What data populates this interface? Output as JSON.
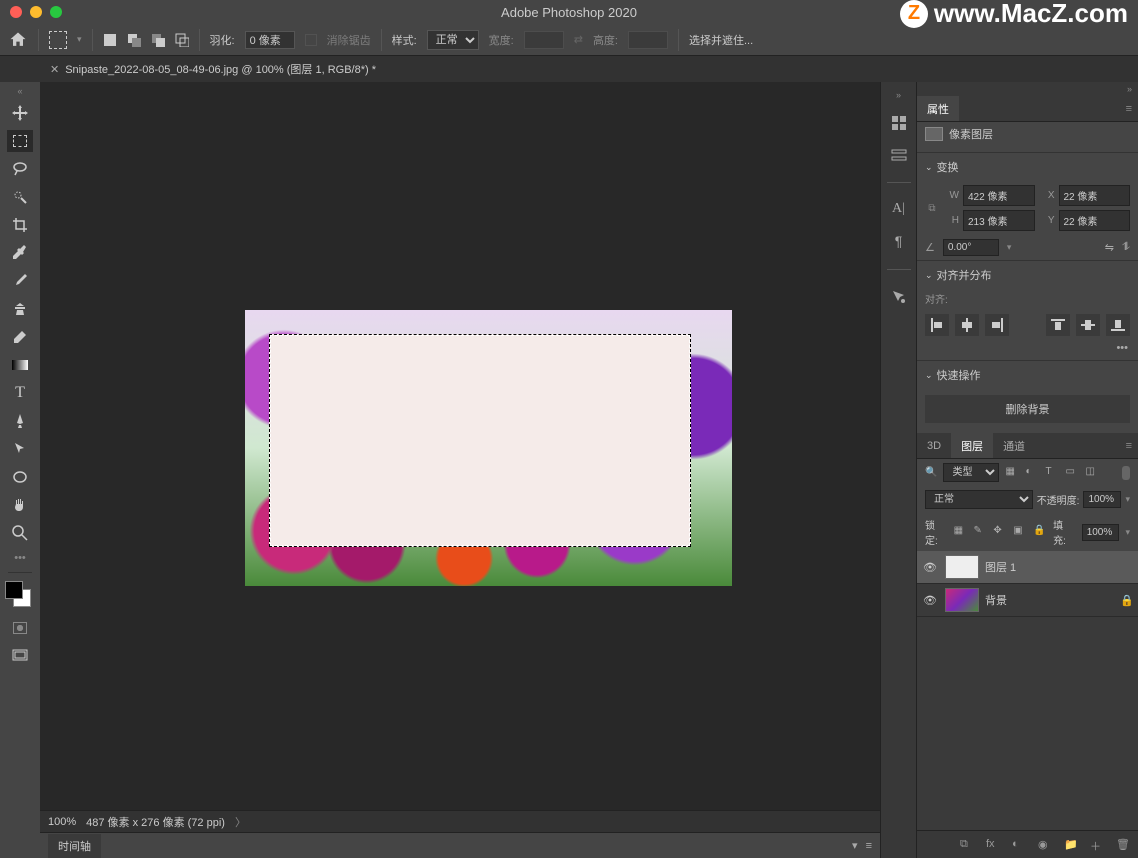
{
  "title": "Adobe Photoshop 2020",
  "watermark": "www.MacZ.com",
  "watermark_badge": "Z",
  "options": {
    "feather_label": "羽化:",
    "feather_value": "0 像素",
    "antialias_label": "消除锯齿",
    "style_label": "样式:",
    "style_value": "正常",
    "width_label": "宽度:",
    "height_label": "高度:",
    "select_mask": "选择并遮住..."
  },
  "tab": "Snipaste_2022-08-05_08-49-06.jpg @ 100% (图层 1, RGB/8*) *",
  "status": {
    "zoom": "100%",
    "info": "487 像素 x 276 像素 (72 ppi)"
  },
  "timeline_label": "时间轴",
  "properties": {
    "tab": "属性",
    "type": "像素图层",
    "transform_hdr": "变换",
    "W": "422 像素",
    "X": "22 像素",
    "H": "213 像素",
    "Y": "22 像素",
    "angle": "0.00°",
    "align_hdr": "对齐并分布",
    "align_label": "对齐:",
    "quick_hdr": "快速操作",
    "remove_bg": "删除背景"
  },
  "layers_panel": {
    "tab_3d": "3D",
    "tab_layers": "图层",
    "tab_channels": "通道",
    "filter_kind": "类型",
    "blend_mode": "正常",
    "opacity_label": "不透明度:",
    "opacity_value": "100%",
    "lock_label": "锁定:",
    "fill_label": "填充:",
    "fill_value": "100%",
    "layers": [
      {
        "name": "图层 1",
        "selected": true,
        "bg": false
      },
      {
        "name": "背景",
        "selected": false,
        "bg": true,
        "locked": true
      }
    ]
  }
}
